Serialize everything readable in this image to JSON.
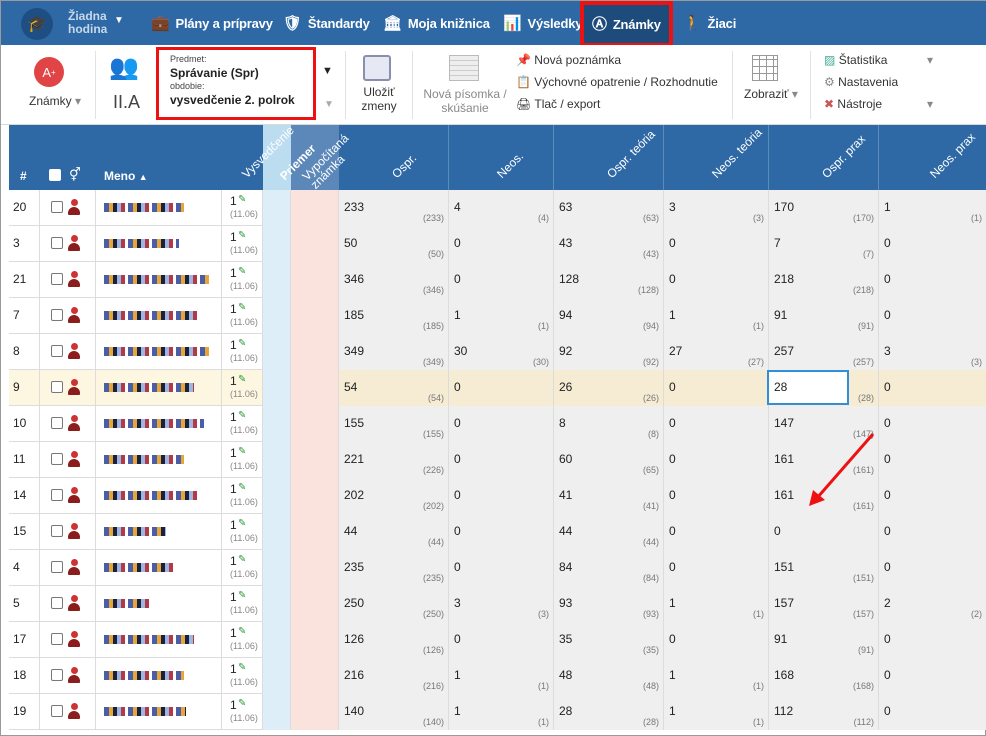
{
  "nav": {
    "hodina": "Žiadna hodina",
    "items": [
      "Plány a prípravy",
      "Štandardy",
      "Moja knižnica",
      "Výsledky",
      "Známky",
      "Žiaci"
    ]
  },
  "toolbar": {
    "znamky_label": "Známky",
    "class_name": "II.A",
    "predmet_label": "Predmet:",
    "predmet_value": "Správanie (Spr)",
    "obdobie_label": "obdobie:",
    "obdobie_value": "vysvedčenie 2. polrok",
    "ulozit": "Uložiť zmeny",
    "nova_pisomka": "Nová písomka / skúšanie",
    "nova_poznamka": "Nová poznámka",
    "vychovne": "Výchovné opatrenie / Rozhodnutie",
    "tlac": "Tlač / export",
    "zobrazit": "Zobraziť",
    "statistika": "Štatistika",
    "nastavenia": "Nastavenia",
    "nastroje": "Nástroje"
  },
  "grid": {
    "headers": {
      "num": "#",
      "meno": "Meno",
      "vysvedcenie": "Vysvedčenie",
      "priemer": "Priemer",
      "vypocitana": "Vypočítaná známka",
      "cols": [
        "Ospr.",
        "Neos.",
        "Ospr. teória",
        "Neos. teória",
        "Ospr. prax",
        "Neos. prax"
      ]
    },
    "rows": [
      {
        "n": "20",
        "g": "1",
        "d": "(11.06)",
        "v": [
          [
            "233",
            "(233)"
          ],
          [
            "4",
            "(4)"
          ],
          [
            "63",
            "(63)"
          ],
          [
            "3",
            "(3)"
          ],
          [
            "170",
            "(170)"
          ],
          [
            "1",
            "(1)"
          ]
        ]
      },
      {
        "n": "3",
        "g": "1",
        "d": "(11.06)",
        "v": [
          [
            "50",
            "(50)"
          ],
          [
            "0",
            ""
          ],
          [
            "43",
            "(43)"
          ],
          [
            "0",
            ""
          ],
          [
            "7",
            "(7)"
          ],
          [
            "0",
            ""
          ]
        ]
      },
      {
        "n": "21",
        "g": "1",
        "d": "(11.06)",
        "v": [
          [
            "346",
            "(346)"
          ],
          [
            "0",
            ""
          ],
          [
            "128",
            "(128)"
          ],
          [
            "0",
            ""
          ],
          [
            "218",
            "(218)"
          ],
          [
            "0",
            ""
          ]
        ]
      },
      {
        "n": "7",
        "g": "1",
        "d": "(11.06)",
        "v": [
          [
            "185",
            "(185)"
          ],
          [
            "1",
            "(1)"
          ],
          [
            "94",
            "(94)"
          ],
          [
            "1",
            "(1)"
          ],
          [
            "91",
            "(91)"
          ],
          [
            "0",
            ""
          ]
        ]
      },
      {
        "n": "8",
        "g": "1",
        "d": "(11.06)",
        "v": [
          [
            "349",
            "(349)"
          ],
          [
            "30",
            "(30)"
          ],
          [
            "92",
            "(92)"
          ],
          [
            "27",
            "(27)"
          ],
          [
            "257",
            "(257)"
          ],
          [
            "3",
            "(3)"
          ]
        ]
      },
      {
        "n": "9",
        "g": "1",
        "d": "(11.06)",
        "v": [
          [
            "54",
            "(54)"
          ],
          [
            "0",
            ""
          ],
          [
            "26",
            "(26)"
          ],
          [
            "0",
            ""
          ],
          [
            "28",
            "(28)"
          ],
          [
            "0",
            ""
          ]
        ]
      },
      {
        "n": "10",
        "g": "1",
        "d": "(11.06)",
        "v": [
          [
            "155",
            "(155)"
          ],
          [
            "0",
            ""
          ],
          [
            "8",
            "(8)"
          ],
          [
            "0",
            ""
          ],
          [
            "147",
            "(147)"
          ],
          [
            "0",
            ""
          ]
        ]
      },
      {
        "n": "11",
        "g": "1",
        "d": "(11.06)",
        "v": [
          [
            "221",
            "(226)"
          ],
          [
            "0",
            ""
          ],
          [
            "60",
            "(65)"
          ],
          [
            "0",
            ""
          ],
          [
            "161",
            "(161)"
          ],
          [
            "0",
            ""
          ]
        ]
      },
      {
        "n": "14",
        "g": "1",
        "d": "(11.06)",
        "v": [
          [
            "202",
            "(202)"
          ],
          [
            "0",
            ""
          ],
          [
            "41",
            "(41)"
          ],
          [
            "0",
            ""
          ],
          [
            "161",
            "(161)"
          ],
          [
            "0",
            ""
          ]
        ]
      },
      {
        "n": "15",
        "g": "1",
        "d": "(11.06)",
        "v": [
          [
            "44",
            "(44)"
          ],
          [
            "0",
            ""
          ],
          [
            "44",
            "(44)"
          ],
          [
            "0",
            ""
          ],
          [
            "0",
            ""
          ],
          [
            "0",
            ""
          ]
        ]
      },
      {
        "n": "4",
        "g": "1",
        "d": "(11.06)",
        "v": [
          [
            "235",
            "(235)"
          ],
          [
            "0",
            ""
          ],
          [
            "84",
            "(84)"
          ],
          [
            "0",
            ""
          ],
          [
            "151",
            "(151)"
          ],
          [
            "0",
            ""
          ]
        ]
      },
      {
        "n": "5",
        "g": "1",
        "d": "(11.06)",
        "v": [
          [
            "250",
            "(250)"
          ],
          [
            "3",
            "(3)"
          ],
          [
            "93",
            "(93)"
          ],
          [
            "1",
            "(1)"
          ],
          [
            "157",
            "(157)"
          ],
          [
            "2",
            "(2)"
          ]
        ]
      },
      {
        "n": "17",
        "g": "1",
        "d": "(11.06)",
        "v": [
          [
            "126",
            "(126)"
          ],
          [
            "0",
            ""
          ],
          [
            "35",
            "(35)"
          ],
          [
            "0",
            ""
          ],
          [
            "91",
            "(91)"
          ],
          [
            "0",
            ""
          ]
        ]
      },
      {
        "n": "18",
        "g": "1",
        "d": "(11.06)",
        "v": [
          [
            "216",
            "(216)"
          ],
          [
            "1",
            "(1)"
          ],
          [
            "48",
            "(48)"
          ],
          [
            "1",
            "(1)"
          ],
          [
            "168",
            "(168)"
          ],
          [
            "0",
            ""
          ]
        ]
      },
      {
        "n": "19",
        "g": "1",
        "d": "(11.06)",
        "v": [
          [
            "140",
            "(140)"
          ],
          [
            "1",
            "(1)"
          ],
          [
            "28",
            "(28)"
          ],
          [
            "1",
            "(1)"
          ],
          [
            "112",
            "(112)"
          ],
          [
            "0",
            ""
          ]
        ]
      }
    ]
  },
  "colors": {
    "nav": "#2e69a6",
    "highlight": "#e11111",
    "selected_row": "#fdf6e0",
    "priemer_col": "#ddeef8",
    "vypocitana_col": "#fbe3dd",
    "data_col": "#efefef"
  }
}
